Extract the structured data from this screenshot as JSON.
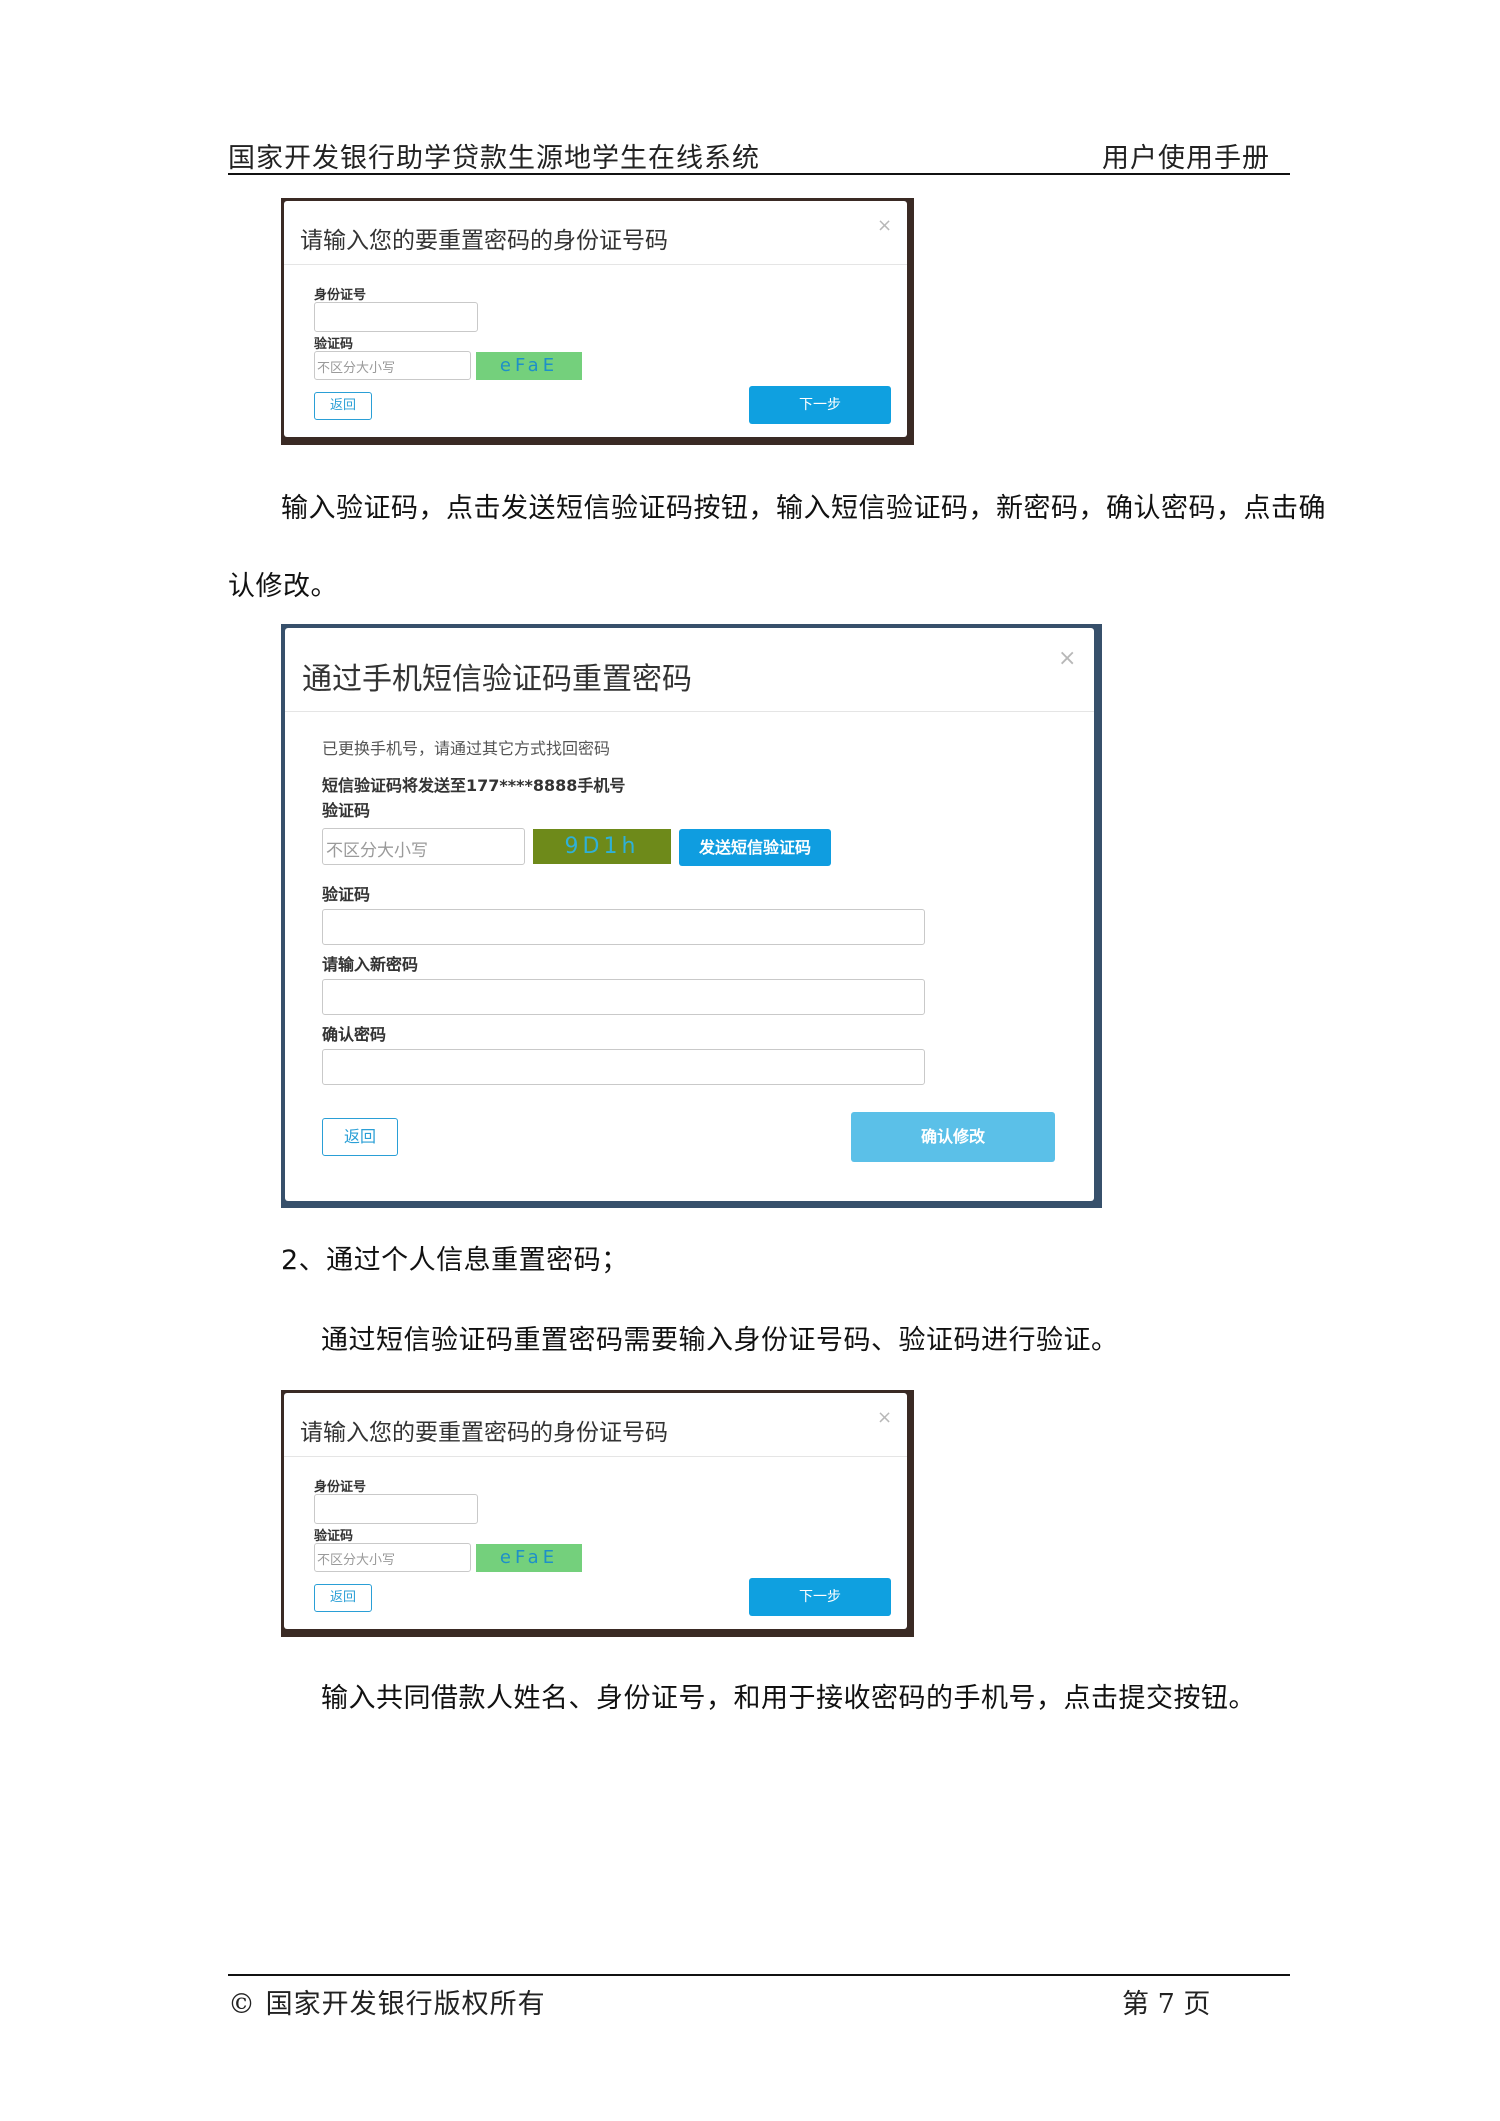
{
  "header": {
    "left_text": "国家开发银行助学贷款生源地学生在线系统",
    "right_text": "用户使用手册"
  },
  "modal_id_reset": {
    "title": "请输入您的要重置密码的身份证号码",
    "close_glyph": "×",
    "id_label": "身份证号",
    "captcha_label": "验证码",
    "captcha_placeholder": "不区分大小写",
    "captcha_code": "eFaE",
    "back_label": "返回",
    "next_label": "下一步"
  },
  "para1": {
    "line1": "输入验证码，点击发送短信验证码按钮，输入短信验证码，新密码，确认密码，点击确",
    "line2": "认修改。"
  },
  "modal_sms": {
    "title": "通过手机短信验证码重置密码",
    "close_glyph": "×",
    "notice": "已更换手机号，请通过其它方式找回密码",
    "send_to": "短信验证码将发送至177****8888手机号",
    "captcha_label": "验证码",
    "captcha_placeholder": "不区分大小写",
    "captcha_code": "9D1h",
    "send_sms_label": "发送短信验证码",
    "sms_code_label": "验证码",
    "new_password_label": "请输入新密码",
    "confirm_password_label": "确认密码",
    "back_label": "返回",
    "confirm_label": "确认修改"
  },
  "section2": {
    "heading": "2、通过个人信息重置密码；",
    "description": "通过短信验证码重置密码需要输入身份证号码、验证码进行验证。"
  },
  "para_final": "输入共同借款人姓名、身份证号，和用于接收密码的手机号，点击提交按钮。",
  "footer": {
    "copyright": "©  国家开发银行版权所有",
    "page_label": "第 7 页"
  },
  "colors": {
    "primary_blue": "#0fa0e0",
    "light_blue": "#5bc0e8",
    "captcha_green": "#74d07c",
    "captcha_olive": "#6e8a1a"
  }
}
